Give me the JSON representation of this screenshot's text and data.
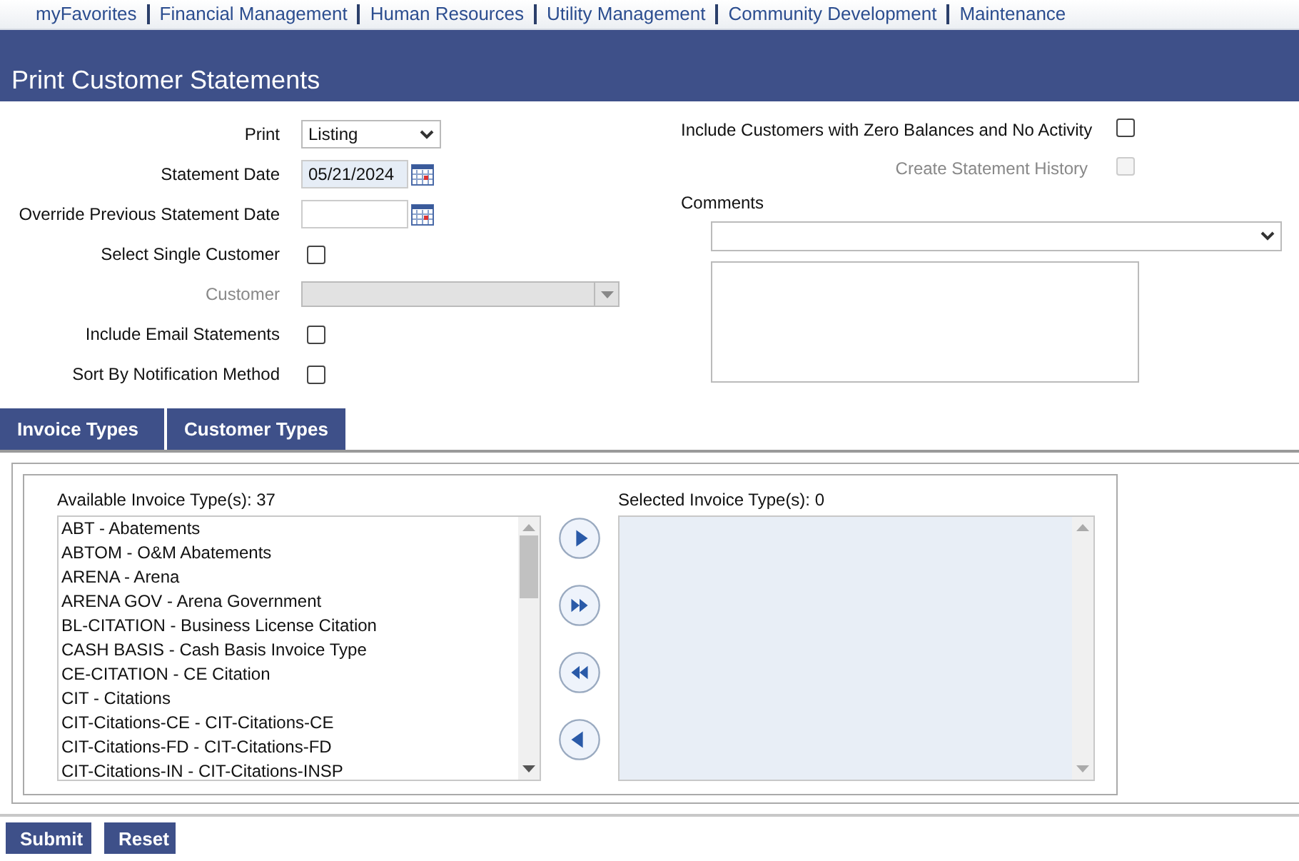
{
  "nav": [
    "myFavorites",
    "Financial Management",
    "Human Resources",
    "Utility Management",
    "Community Development",
    "Maintenance"
  ],
  "title": "Print Customer Statements",
  "left_fields": [
    {
      "kind": "select",
      "label": "Print",
      "value": "Listing",
      "disabled": false
    },
    {
      "kind": "date",
      "label": "Statement Date",
      "value": "05/21/2024",
      "disabled": false
    },
    {
      "kind": "date",
      "label": "Override Previous Statement Date",
      "disabled": false
    },
    {
      "kind": "checkbox",
      "label": "Select Single Customer",
      "checked": false,
      "disabled": false
    },
    {
      "kind": "combo",
      "label": "Customer",
      "disabled": true
    },
    {
      "kind": "checkbox",
      "label": "Include Email Statements",
      "checked": false,
      "disabled": false
    },
    {
      "kind": "checkbox",
      "label": "Sort By Notification Method",
      "checked": false,
      "disabled": false
    }
  ],
  "right_fields": [
    {
      "label": "Include Customers with Zero Balances and No Activity",
      "checked": false,
      "disabled": false
    },
    {
      "label": "Create Statement History",
      "checked": false,
      "disabled": true
    }
  ],
  "comments": {
    "label": "Comments"
  },
  "tabs": [
    "Invoice Types",
    "Customer Types"
  ],
  "available": {
    "label": "Available Invoice Type(s): 37",
    "items": [
      "ABT - Abatements",
      "ABTOM - O&M Abatements",
      "ARENA - Arena",
      "ARENA GOV - Arena Government",
      "BL-CITATION - Business License Citation",
      "CASH BASIS - Cash Basis Invoice Type",
      "CE-CITATION - CE Citation",
      "CIT - Citations",
      "CIT-Citations-CE - CIT-Citations-CE",
      "CIT-Citations-FD - CIT-Citations-FD",
      "CIT-Citations-IN - CIT-Citations-INSP"
    ]
  },
  "selected": {
    "label": "Selected Invoice Type(s): 0"
  },
  "buttons": [
    "Submit",
    "Reset"
  ]
}
